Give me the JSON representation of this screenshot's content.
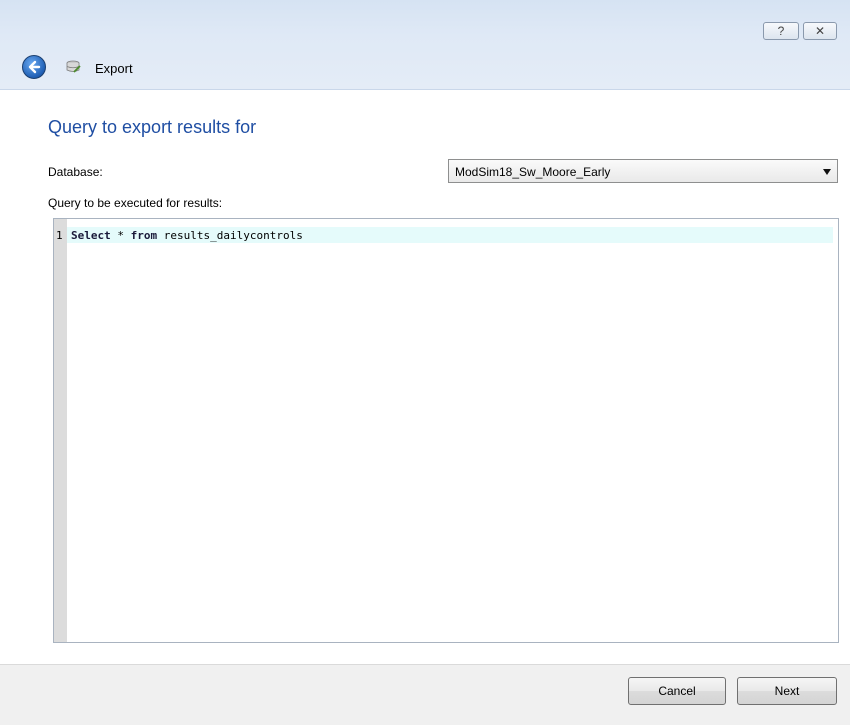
{
  "window": {
    "title": "Export",
    "help_glyph": "?",
    "close_glyph": "✕"
  },
  "page": {
    "heading": "Query to export results for"
  },
  "form": {
    "database_label": "Database:",
    "database_value": "ModSim18_Sw_Moore_Early",
    "query_label": "Query to be executed for results:"
  },
  "editor": {
    "line_number": "1",
    "tokens": {
      "kw_select": "Select",
      "star": " * ",
      "kw_from": "from",
      "table": " results_dailycontrols"
    }
  },
  "footer": {
    "cancel_label": "Cancel",
    "next_label": "Next"
  },
  "colors": {
    "heading": "#1f4ea3",
    "current_line": "#e5fbfb",
    "gutter": "#dcdcdc"
  }
}
